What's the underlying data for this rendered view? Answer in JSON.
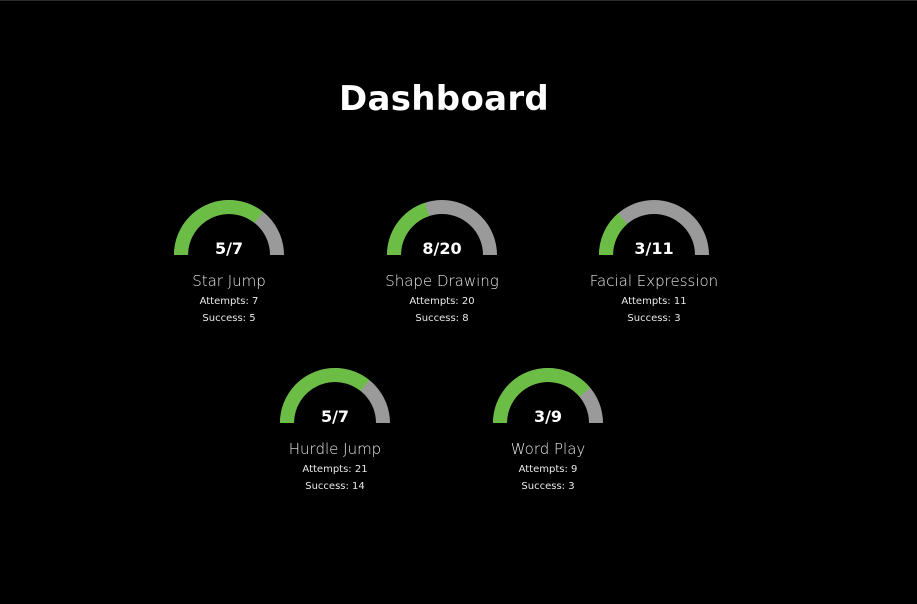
{
  "page": {
    "title": "Dashboard"
  },
  "colors": {
    "success": "#6cbd45",
    "remaining": "#9a9a9a",
    "background": "#000000",
    "text": "#ffffff"
  },
  "labels": {
    "attempts": "Attempts:",
    "success": "Success:"
  },
  "cards": [
    {
      "name": "Star Jump",
      "ratio": "5/7",
      "fraction": 0.714,
      "attempts": "7",
      "success": "5",
      "attempts_text": "Attempts: 7",
      "success_text": "Success: 5"
    },
    {
      "name": "Shape Drawing",
      "ratio": "8/20",
      "fraction": 0.4,
      "attempts": "20",
      "success": "8",
      "attempts_text": "Attempts: 20",
      "success_text": "Success: 8"
    },
    {
      "name": "Facial Expression",
      "ratio": "3/11",
      "fraction": 0.273,
      "attempts": "11",
      "success": "3",
      "attempts_text": "Attempts: 11",
      "success_text": "Success: 3"
    },
    {
      "name": "Hurdle Jump",
      "ratio": "5/7",
      "fraction": 0.714,
      "attempts": "21",
      "success": "14",
      "attempts_text": "Attempts: 21",
      "success_text": "Success: 14"
    },
    {
      "name": "Word Play",
      "ratio": "3/9",
      "fraction": 0.778,
      "attempts": "9",
      "success": "3",
      "attempts_text": "Attempts: 9",
      "success_text": "Success: 3"
    }
  ]
}
